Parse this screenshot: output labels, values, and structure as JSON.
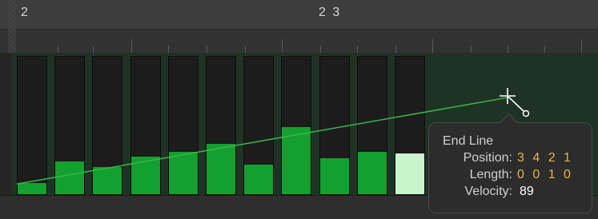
{
  "ruler": {
    "bar_labels": [
      "2",
      "2 3"
    ]
  },
  "velocity_lane": {
    "max_velocity": 127,
    "notes": [
      {
        "velocity": 10
      },
      {
        "velocity": 30
      },
      {
        "velocity": 25
      },
      {
        "velocity": 34
      },
      {
        "velocity": 39
      },
      {
        "velocity": 46
      },
      {
        "velocity": 27
      },
      {
        "velocity": 61
      },
      {
        "velocity": 33
      },
      {
        "velocity": 39
      },
      {
        "velocity": 37,
        "selected": true
      }
    ],
    "line_start_velocity": 10,
    "line_end_velocity": 89
  },
  "tooltip": {
    "title": "End Line",
    "position_label": "Position:",
    "position_value": "3 4 2 1",
    "length_label": "Length:",
    "length_value": "0 0 1 0",
    "velocity_label": "Velocity:",
    "velocity_value": "89"
  },
  "colors": {
    "note_fill": "#14a02e",
    "selected_note_fill": "#c8f5cc",
    "line": "#3cb54a",
    "value_accent": "#e7b24a"
  }
}
